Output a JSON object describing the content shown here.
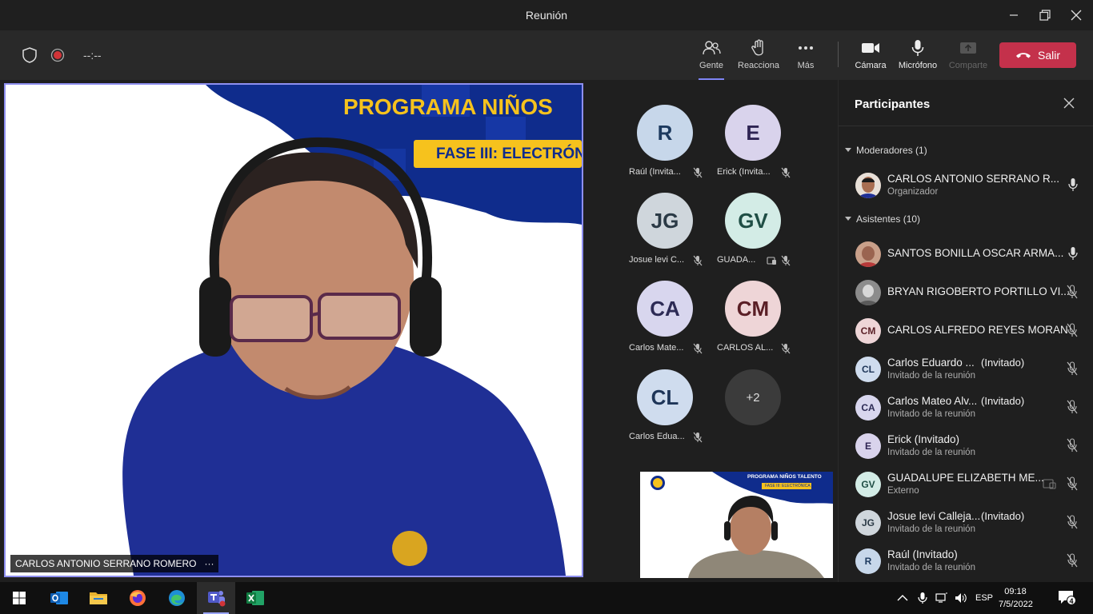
{
  "window": {
    "title": "Reunión"
  },
  "toolbar": {
    "timer": "--:--",
    "people_label": "Gente",
    "react_label": "Reacciona",
    "more_label": "Más",
    "camera_label": "Cámara",
    "mic_label": "Micrófono",
    "share_label": "Comparte",
    "leave_label": "Salir"
  },
  "main_video": {
    "banner_title": "PROGRAMA NIÑOS",
    "banner_phase": "FASE III: ELECTRÓN",
    "speaker_name": "CARLOS ANTONIO SERRANO ROMERO",
    "more_glyph": "···"
  },
  "tiles": [
    {
      "initials": "R",
      "name": "Raúl (Invita...",
      "bg": "#c7d7ea",
      "fg": "#1d3a5f"
    },
    {
      "initials": "E",
      "name": "Erick (Invita...",
      "bg": "#d9d3ec",
      "fg": "#2e2453"
    },
    {
      "initials": "JG",
      "name": "Josue levi C...",
      "bg": "#cfd6dc",
      "fg": "#2b3a46"
    },
    {
      "initials": "GV",
      "name": "GUADA...",
      "bg": "#d3ece6",
      "fg": "#1f4e45"
    },
    {
      "initials": "CA",
      "name": "Carlos Mate...",
      "bg": "#d8d6ee",
      "fg": "#2d2b55"
    },
    {
      "initials": "CM",
      "name": "CARLOS AL...",
      "bg": "#eed5d7",
      "fg": "#5a1f26"
    },
    {
      "initials": "CL",
      "name": "Carlos Edua...",
      "bg": "#cfdcee",
      "fg": "#1e3558"
    }
  ],
  "overflow_tile": {
    "label": "+2"
  },
  "self_view": {
    "banner_title": "PROGRAMA NIÑOS TALENTO",
    "banner_phase": "FASE III: ELECTRÓNICA"
  },
  "panel": {
    "title": "Participantes",
    "moderators_header": "Moderadores (1)",
    "attendees_header": "Asistentes (10)",
    "moderator": {
      "name": "CARLOS ANTONIO SERRANO R...",
      "sub": "Organizador"
    },
    "attendees": [
      {
        "initials": "",
        "name": "SANTOS BONILLA OSCAR ARMA...",
        "sub": "",
        "invited": "",
        "bg": "#b73a3a",
        "fg": "#fff",
        "mic": "on"
      },
      {
        "initials": "",
        "name": "BRYAN RIGOBERTO PORTILLO VI...",
        "sub": "",
        "invited": "",
        "bg": "#9a9a9a",
        "fg": "#fff",
        "mic": "off"
      },
      {
        "initials": "CM",
        "name": "CARLOS ALFREDO REYES MORAN",
        "sub": "",
        "invited": "",
        "bg": "#eed5d7",
        "fg": "#5a1f26",
        "mic": "off"
      },
      {
        "initials": "CL",
        "name": "Carlos Eduardo ...",
        "sub": "Invitado de la reunión",
        "invited": "(Invitado)",
        "bg": "#cfdcee",
        "fg": "#1e3558",
        "mic": "off"
      },
      {
        "initials": "CA",
        "name": "Carlos Mateo Alv...",
        "sub": "Invitado de la reunión",
        "invited": "(Invitado)",
        "bg": "#d8d6ee",
        "fg": "#2d2b55",
        "mic": "off"
      },
      {
        "initials": "E",
        "name": "Erick (Invitado)",
        "sub": "Invitado de la reunión",
        "invited": "",
        "bg": "#d9d3ec",
        "fg": "#2e2453",
        "mic": "off"
      },
      {
        "initials": "GV",
        "name": "GUADALUPE ELIZABETH ME...",
        "sub": "Externo",
        "invited": "",
        "bg": "#d3ece6",
        "fg": "#1f4e45",
        "mic": "off"
      },
      {
        "initials": "JG",
        "name": "Josue levi Calleja...",
        "sub": "Invitado de la reunión",
        "invited": "(Invitado)",
        "bg": "#cfd6dc",
        "fg": "#2b3a46",
        "mic": "off"
      },
      {
        "initials": "R",
        "name": "Raúl (Invitado)",
        "sub": "Invitado de la reunión",
        "invited": "",
        "bg": "#c7d7ea",
        "fg": "#1d3a5f",
        "mic": "off"
      }
    ]
  },
  "taskbar": {
    "lang": "ESP",
    "time": "09:18",
    "date": "7/5/2022",
    "notif_count": "4"
  }
}
